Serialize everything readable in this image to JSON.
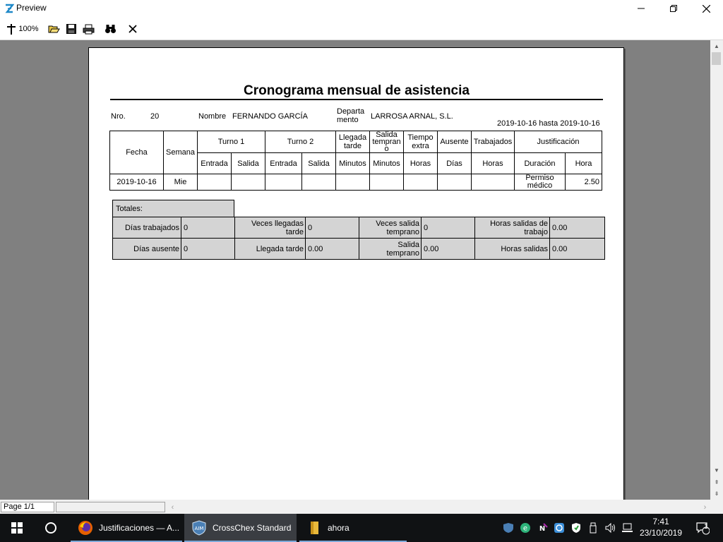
{
  "window": {
    "title": "Preview"
  },
  "toolbar": {
    "zoom_label": "100%"
  },
  "report": {
    "title": "Cronograma mensual de asistencia",
    "nro_label": "Nro.",
    "nro_value": "20",
    "nombre_label": "Nombre",
    "nombre_value": "FERNANDO GARCÍA",
    "departamento_label_1": "Departa",
    "departamento_label_2": "mento",
    "departamento_value": "LARROSA ARNAL, S.L.",
    "date_range": "2019-10-16 hasta 2019-10-16",
    "columns": {
      "fecha": "Fecha",
      "semana": "Semana",
      "turno1": "Turno 1",
      "turno2": "Turno 2",
      "llegada_tarde_1": "Llegada",
      "llegada_tarde_2": "tarde",
      "salida_temprano_1": "Salida",
      "salida_temprano_2": "tempran",
      "salida_temprano_3": "o",
      "tiempo_extra_1": "Tiempo",
      "tiempo_extra_2": "extra",
      "ausente": "Ausente",
      "trabajados": "Trabajados",
      "justificacion": "Justificación",
      "entrada": "Entrada",
      "salida": "Salida",
      "minutos": "Minutos",
      "horas": "Horas",
      "dias": "Días",
      "duracion": "Duración",
      "hora": "Hora"
    },
    "row": {
      "fecha": "2019-10-16",
      "semana": "Mie",
      "justificacion_1": "Permiso",
      "justificacion_2": "médico",
      "hora": "2.50"
    },
    "totals": {
      "label": "Totales:",
      "dias_trabajados_label": "Días trabajados",
      "dias_trabajados_value": "0",
      "veces_llegadas_tarde_label_1": "Veces llegadas",
      "veces_llegadas_tarde_label_2": "tarde",
      "veces_llegadas_tarde_value": "0",
      "veces_salida_temprano_label_1": "Veces salida",
      "veces_salida_temprano_label_2": "temprano",
      "veces_salida_temprano_value": "0",
      "horas_salidas_trabajo_label_1": "Horas salidas de",
      "horas_salidas_trabajo_label_2": "trabajo",
      "horas_salidas_trabajo_value": "0.00",
      "dias_ausente_label": "Días ausente",
      "dias_ausente_value": "0",
      "llegada_tarde_label": "Llegada tarde",
      "llegada_tarde_value": "0.00",
      "salida_temprano_label_1": "Salida",
      "salida_temprano_label_2": "temprano",
      "salida_temprano_value": "0.00",
      "horas_salidas_label": "Horas salidas",
      "horas_salidas_value": "0.00"
    }
  },
  "statusbar": {
    "page": "Page 1/1"
  },
  "taskbar": {
    "apps": [
      {
        "label": "Justificaciones — A..."
      },
      {
        "label": "CrossChex Standard"
      },
      {
        "label": "ahora"
      }
    ],
    "time": "7:41",
    "date": "23/10/2019",
    "notification_count": "1"
  },
  "colors": {
    "viewer_bg": "#808080",
    "taskbar_bg": "#101214",
    "totals_bg": "#d4d4d4",
    "accent": "#7ca8d8"
  }
}
